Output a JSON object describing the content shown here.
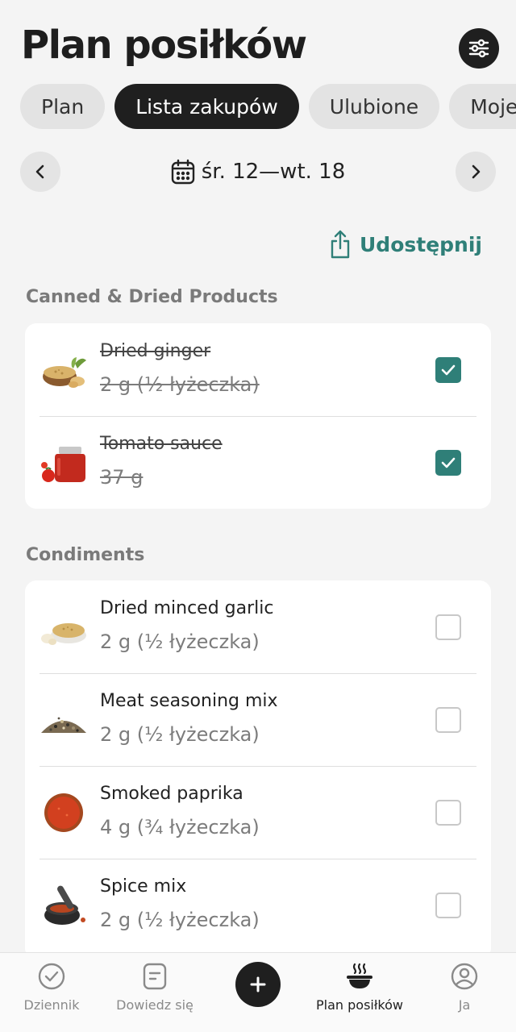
{
  "header": {
    "title": "Plan posiłków"
  },
  "tabs": [
    {
      "label": "Plan"
    },
    {
      "label": "Lista zakupów",
      "active": true
    },
    {
      "label": "Ulubione"
    },
    {
      "label": "Moje"
    }
  ],
  "date_range": {
    "label": "śr. 12—wt. 18"
  },
  "share": {
    "label": "Udostępnij"
  },
  "sections": [
    {
      "title": "Canned & Dried Products",
      "items": [
        {
          "name": "Dried ginger",
          "qty": "2 g (½ łyżeczka)",
          "checked": true,
          "icon": "ginger-icon"
        },
        {
          "name": "Tomato sauce",
          "qty": "37 g",
          "checked": true,
          "icon": "tomato-sauce-icon"
        }
      ]
    },
    {
      "title": "Condiments",
      "items": [
        {
          "name": "Dried minced garlic",
          "qty": "2 g (½ łyżeczka)",
          "checked": false,
          "icon": "garlic-icon"
        },
        {
          "name": "Meat seasoning mix",
          "qty": "2 g (½ łyżeczka)",
          "checked": false,
          "icon": "seasoning-icon"
        },
        {
          "name": "Smoked paprika",
          "qty": "4 g (¾ łyżeczka)",
          "checked": false,
          "icon": "paprika-icon"
        },
        {
          "name": "Spice mix",
          "qty": "2 g (½ łyżeczka)",
          "checked": false,
          "icon": "spice-mix-icon"
        }
      ]
    }
  ],
  "bottom_nav": [
    {
      "label": "Dziennik",
      "icon": "check-circle-icon"
    },
    {
      "label": "Dowiedz się",
      "icon": "document-icon"
    },
    {
      "label": "",
      "icon": "plus-icon"
    },
    {
      "label": "Plan posiłków",
      "icon": "bowl-icon",
      "active": true
    },
    {
      "label": "Ja",
      "icon": "user-icon"
    }
  ],
  "colors": {
    "accent": "#2f7f78",
    "dark": "#1f1f1f",
    "background": "#f4f4f4"
  }
}
